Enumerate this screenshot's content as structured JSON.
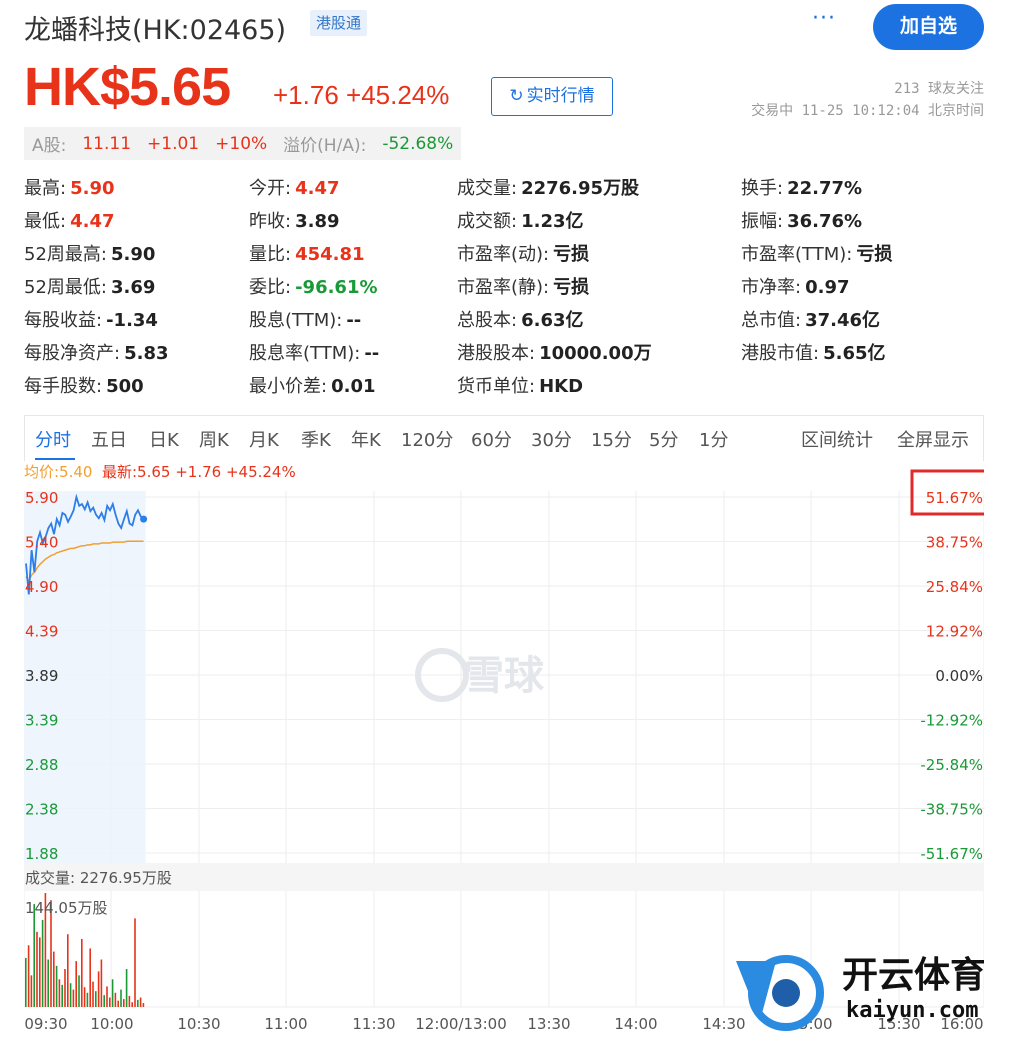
{
  "header": {
    "title": "龙蟠科技(HK:02465)",
    "badge": "港股通",
    "more": "···",
    "follow_label": "加自选"
  },
  "quote": {
    "price": "HK$5.65",
    "change": "+1.76 +45.24%",
    "realtime_label": "实时行情",
    "refresh_icon": "↻",
    "followers": "213 球友关注",
    "trade_status": "交易中 11-25 10:12:04 北京时间"
  },
  "a_share": {
    "label": "A股:",
    "price": "11.11",
    "change": "+1.01",
    "pct": "+10%",
    "premium_label": "溢价(H/A):",
    "premium": "-52.68%"
  },
  "stats": [
    {
      "label": "最高:",
      "value": "5.90",
      "tone": "red"
    },
    {
      "label": "今开:",
      "value": "4.47",
      "tone": "red"
    },
    {
      "label": "成交量:",
      "value": "2276.95万股",
      "tone": ""
    },
    {
      "label": "换手:",
      "value": "22.77%",
      "tone": ""
    },
    {
      "label": "最低:",
      "value": "4.47",
      "tone": "red"
    },
    {
      "label": "昨收:",
      "value": "3.89",
      "tone": ""
    },
    {
      "label": "成交额:",
      "value": "1.23亿",
      "tone": ""
    },
    {
      "label": "振幅:",
      "value": "36.76%",
      "tone": ""
    },
    {
      "label": "52周最高:",
      "value": "5.90",
      "tone": ""
    },
    {
      "label": "量比:",
      "value": "454.81",
      "tone": "red"
    },
    {
      "label": "市盈率(动):",
      "value": "亏损",
      "tone": ""
    },
    {
      "label": "市盈率(TTM):",
      "value": "亏损",
      "tone": ""
    },
    {
      "label": "52周最低:",
      "value": "3.69",
      "tone": ""
    },
    {
      "label": "委比:",
      "value": "-96.61%",
      "tone": "green"
    },
    {
      "label": "市盈率(静):",
      "value": "亏损",
      "tone": ""
    },
    {
      "label": "市净率:",
      "value": "0.97",
      "tone": ""
    },
    {
      "label": "每股收益:",
      "value": "-1.34",
      "tone": ""
    },
    {
      "label": "股息(TTM):",
      "value": "--",
      "tone": ""
    },
    {
      "label": "总股本:",
      "value": "6.63亿",
      "tone": ""
    },
    {
      "label": "总市值:",
      "value": "37.46亿",
      "tone": ""
    },
    {
      "label": "每股净资产:",
      "value": "5.83",
      "tone": ""
    },
    {
      "label": "股息率(TTM):",
      "value": "--",
      "tone": ""
    },
    {
      "label": "港股股本:",
      "value": "10000.00万",
      "tone": ""
    },
    {
      "label": "港股市值:",
      "value": "5.65亿",
      "tone": ""
    },
    {
      "label": "每手股数:",
      "value": "500",
      "tone": ""
    },
    {
      "label": "最小价差:",
      "value": "0.01",
      "tone": ""
    },
    {
      "label": "货币单位:",
      "value": "HKD",
      "tone": ""
    }
  ],
  "tabs": [
    {
      "label": "分时",
      "active": true
    },
    {
      "label": "五日"
    },
    {
      "label": "日K"
    },
    {
      "label": "周K"
    },
    {
      "label": "月K"
    },
    {
      "label": "季K"
    },
    {
      "label": "年K"
    },
    {
      "label": "120分"
    },
    {
      "label": "60分"
    },
    {
      "label": "30分"
    },
    {
      "label": "15分"
    },
    {
      "label": "5分"
    },
    {
      "label": "1分"
    }
  ],
  "tab_actions": {
    "range_stats": "区间统计",
    "fullscreen": "全屏显示"
  },
  "chart_legend": {
    "avg": "均价:5.40",
    "latest": "最新:5.65 +1.76 +45.24%"
  },
  "watermark": "雪球",
  "brand_logo": {
    "name": "开云体育",
    "domain": "kaiyun.com"
  },
  "colors": {
    "up": "#e8331b",
    "down": "#1a9a37",
    "accent": "#1d72e2",
    "avg_line": "#f0a030"
  },
  "chart_data": {
    "type": "line",
    "prev_close": 3.89,
    "ylim": [
      1.88,
      5.9
    ],
    "price_ticks": [
      "5.90",
      "5.40",
      "4.90",
      "4.39",
      "3.89",
      "3.39",
      "2.88",
      "2.38",
      "1.88"
    ],
    "pct_ticks": [
      "51.67%",
      "38.75%",
      "25.84%",
      "12.92%",
      "0.00%",
      "-12.92%",
      "-25.84%",
      "-38.75%",
      "-51.67%"
    ],
    "x_ticks": [
      "09:30",
      "10:00",
      "10:30",
      "11:00",
      "11:30",
      "12:00/13:00",
      "13:30",
      "14:00",
      "14:30",
      "15:00",
      "15:30",
      "16:00"
    ],
    "series": [
      {
        "name": "最新",
        "values": [
          5.15,
          4.8,
          5.3,
          5.05,
          5.4,
          5.5,
          5.38,
          5.45,
          5.55,
          5.6,
          5.48,
          5.65,
          5.58,
          5.72,
          5.7,
          5.62,
          5.68,
          5.75,
          5.9,
          5.8,
          5.82,
          5.76,
          5.84,
          5.74,
          5.78,
          5.7,
          5.66,
          5.72,
          5.64,
          5.8,
          5.75,
          5.82,
          5.7,
          5.6,
          5.55,
          5.65,
          5.74,
          5.6,
          5.58,
          5.7,
          5.75,
          5.68,
          5.65
        ]
      },
      {
        "name": "均价",
        "values": [
          5.0,
          4.95,
          5.02,
          5.05,
          5.1,
          5.14,
          5.17,
          5.2,
          5.22,
          5.24,
          5.25,
          5.27,
          5.28,
          5.29,
          5.3,
          5.31,
          5.32,
          5.32,
          5.33,
          5.34,
          5.35,
          5.35,
          5.36,
          5.36,
          5.37,
          5.37,
          5.37,
          5.38,
          5.38,
          5.38,
          5.38,
          5.39,
          5.39,
          5.39,
          5.39,
          5.39,
          5.4,
          5.4,
          5.4,
          5.4,
          5.4,
          5.4,
          5.4
        ]
      }
    ],
    "volume_label": "成交量: 2276.95万股",
    "volume_max_label": "144.05万股",
    "volume_max": 144.05,
    "volume": [
      {
        "v": 62,
        "up": false
      },
      {
        "v": 78,
        "up": true
      },
      {
        "v": 40,
        "up": true
      },
      {
        "v": 130,
        "up": false
      },
      {
        "v": 95,
        "up": true
      },
      {
        "v": 88,
        "up": true
      },
      {
        "v": 110,
        "up": false
      },
      {
        "v": 144,
        "up": true
      },
      {
        "v": 60,
        "up": false
      },
      {
        "v": 135,
        "up": true
      },
      {
        "v": 70,
        "up": true
      },
      {
        "v": 52,
        "up": false
      },
      {
        "v": 35,
        "up": true
      },
      {
        "v": 28,
        "up": false
      },
      {
        "v": 48,
        "up": true
      },
      {
        "v": 92,
        "up": true
      },
      {
        "v": 30,
        "up": false
      },
      {
        "v": 22,
        "up": true
      },
      {
        "v": 58,
        "up": true
      },
      {
        "v": 40,
        "up": false
      },
      {
        "v": 86,
        "up": true
      },
      {
        "v": 25,
        "up": true
      },
      {
        "v": 18,
        "up": false
      },
      {
        "v": 74,
        "up": true
      },
      {
        "v": 32,
        "up": true
      },
      {
        "v": 20,
        "up": false
      },
      {
        "v": 45,
        "up": true
      },
      {
        "v": 60,
        "up": true
      },
      {
        "v": 15,
        "up": false
      },
      {
        "v": 26,
        "up": true
      },
      {
        "v": 12,
        "up": true
      },
      {
        "v": 35,
        "up": false
      },
      {
        "v": 18,
        "up": true
      },
      {
        "v": 8,
        "up": true
      },
      {
        "v": 22,
        "up": false
      },
      {
        "v": 10,
        "up": true
      },
      {
        "v": 48,
        "up": false
      },
      {
        "v": 14,
        "up": true
      },
      {
        "v": 6,
        "up": true
      },
      {
        "v": 112,
        "up": true
      },
      {
        "v": 9,
        "up": false
      },
      {
        "v": 12,
        "up": true
      },
      {
        "v": 5,
        "up": true
      }
    ]
  }
}
